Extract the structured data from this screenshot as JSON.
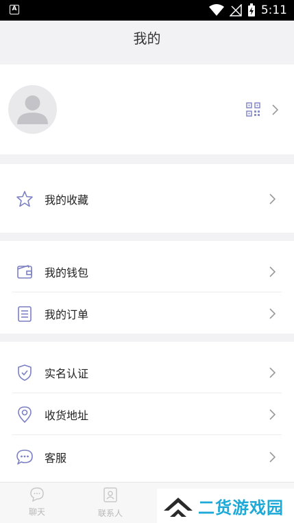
{
  "status_bar": {
    "time": "5:11"
  },
  "header": {
    "title": "我的"
  },
  "menu": {
    "favorites": "我的收藏",
    "wallet": "我的钱包",
    "orders": "我的订单",
    "verification": "实名认证",
    "address": "收货地址",
    "service": "客服"
  },
  "tabbar": {
    "chat": "聊天",
    "contacts": "联系人"
  },
  "watermark": {
    "text": "二货游戏园"
  },
  "colors": {
    "accent": "#7b7fc4",
    "chevron": "#999999",
    "background": "#f2f2f5"
  }
}
